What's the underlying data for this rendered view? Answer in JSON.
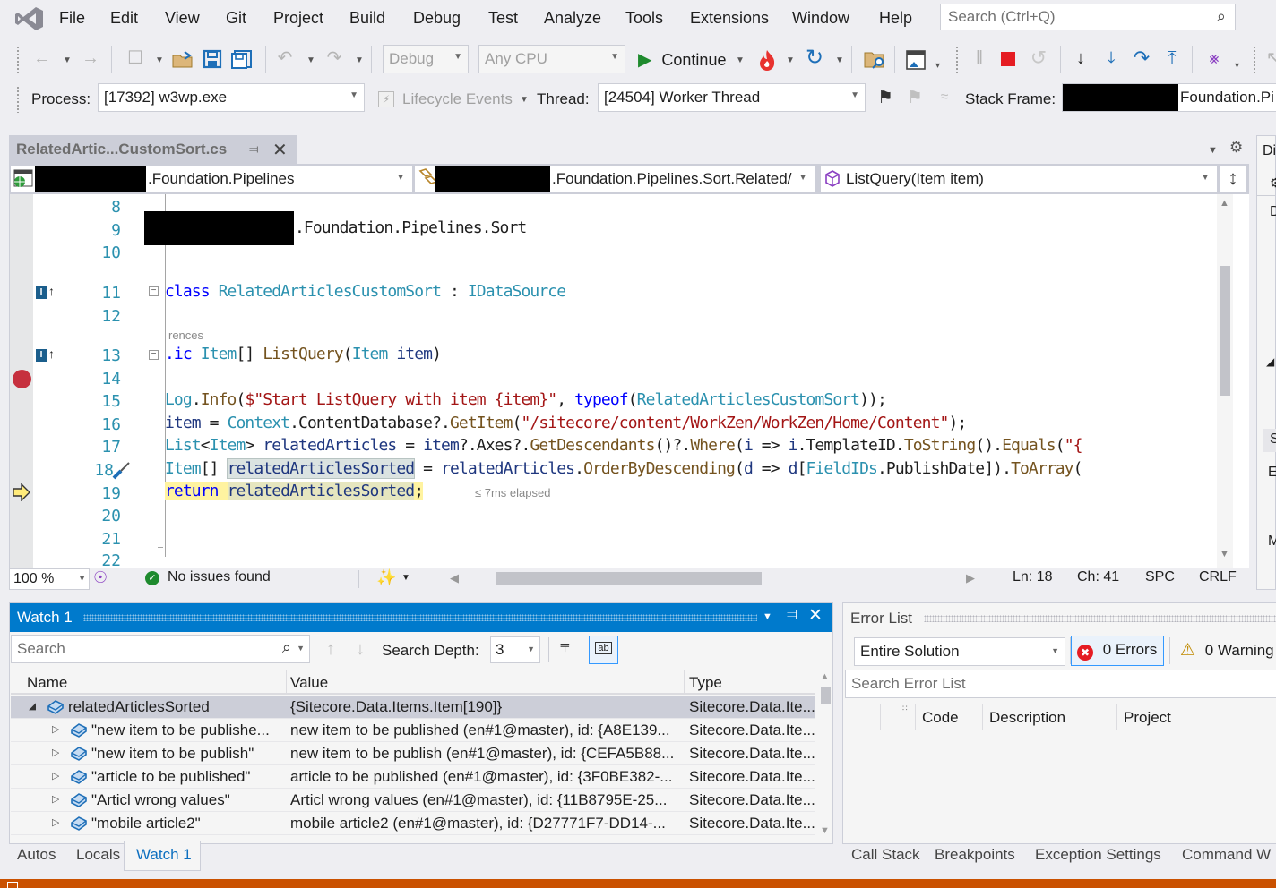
{
  "menu": [
    "File",
    "Edit",
    "View",
    "Git",
    "Project",
    "Build",
    "Debug",
    "Test",
    "Analyze",
    "Tools",
    "Extensions",
    "Window",
    "Help"
  ],
  "search": {
    "placeholder": "Search (Ctrl+Q)"
  },
  "toolbar": {
    "configuration": "Debug",
    "platform": "Any CPU",
    "continue_label": "Continue"
  },
  "debug_location": {
    "process_label": "Process:",
    "process_value": "[17392] w3wp.exe",
    "lifecycle_label": "Lifecycle Events",
    "thread_label": "Thread:",
    "thread_value": "[24504] Worker Thread",
    "stack_frame_label": "Stack Frame:",
    "stack_frame_value": "Foundation.Pi"
  },
  "editor": {
    "tab_title": "RelatedArtic...CustomSort.cs",
    "nav_project": ".Foundation.Pipelines",
    "nav_type": ".Foundation.Pipelines.Sort.Related/",
    "nav_member": "ListQuery(Item item)",
    "line_numbers": [
      "8",
      "9",
      "10",
      "11",
      "12",
      "13",
      "14",
      "15",
      "16",
      "17",
      "18",
      "19",
      "20",
      "21",
      "22"
    ],
    "codelens": "rences",
    "elapsed": "≤ 7ms elapsed",
    "code": {
      "l9": ".Foundation.Pipelines.Sort",
      "l11_kw": "class",
      "l11_name": "RelatedArticlesCustomSort",
      "l11_sep": " : ",
      "l11_iface": "IDataSource",
      "l13_pre": ".ic",
      "l13_type": "Item",
      "l13_arr": "[] ",
      "l13_method": "ListQuery",
      "l13_paren": "(",
      "l13_ptype": "Item",
      "l13_pname": "item",
      "l13_close": ")",
      "l15": {
        "t1": "Log",
        "t2": ".",
        "t3": "Info",
        "t4": "(",
        "t5": "$\"Start ListQuery with item {item}\"",
        "t6": ", ",
        "t7": "typeof",
        "t8": "(",
        "t9": "RelatedArticlesCustomSort",
        "t10": "));"
      },
      "l16": {
        "t1": "item",
        "t2": " = ",
        "t3": "Context",
        "t4": ".ContentDatabase?.",
        "t5": "GetItem",
        "t6": "(",
        "t7": "\"/sitecore/content/WorkZen/WorkZen/Home/Content\"",
        "t8": ");"
      },
      "l17": {
        "t1": "List",
        "t2": "<",
        "t3": "Item",
        "t4": "> ",
        "t5": "relatedArticles",
        "t6": " = ",
        "t7": "item",
        "t8": "?.Axes?.",
        "t9": "GetDescendants",
        "t10": "()?.",
        "t11": "Where",
        "t12": "(",
        "t13": "i",
        "t14": " => ",
        "t15": "i",
        "t16": ".TemplateID.",
        "t17": "ToString",
        "t18": "().",
        "t19": "Equals",
        "t20": "(",
        "t21": "\"{"
      },
      "l18": {
        "t1": "Item",
        "t2": "[] ",
        "t3": "relatedArticlesSorted",
        "t4": " = ",
        "t5": "relatedArticles",
        "t6": ".",
        "t7": "OrderByDescending",
        "t8": "(",
        "t9": "d",
        "t10": " => ",
        "t11": "d",
        "t12": "[",
        "t13": "FieldIDs",
        "t14": ".PublishDate]).",
        "t15": "ToArray",
        "t16": "("
      },
      "l19": {
        "t1": "return ",
        "t2": "relatedArticlesSorted",
        "t3": ";"
      }
    }
  },
  "editor_status": {
    "zoom": "100 %",
    "issues": "No issues found",
    "ln": "Ln: 18",
    "ch": "Ch: 41",
    "spc": "SPC",
    "crlf": "CRLF"
  },
  "watch": {
    "title": "Watch 1",
    "search_placeholder": "Search",
    "search_depth_label": "Search Depth:",
    "search_depth_value": "3",
    "columns": [
      "Name",
      "Value",
      "Type"
    ],
    "rows": [
      {
        "name": "relatedArticlesSorted",
        "value": "{Sitecore.Data.Items.Item[190]}",
        "type": "Sitecore.Data.Ite...",
        "expanded": true
      },
      {
        "name": "\"new item to be publishe...",
        "value": "new item to be published (en#1@master), id: {A8E139...",
        "type": "Sitecore.Data.Ite..."
      },
      {
        "name": "\"new item to be publish\"",
        "value": "new item to be publish (en#1@master), id: {CEFA5B88...",
        "type": "Sitecore.Data.Ite..."
      },
      {
        "name": "\"article to be published\"",
        "value": "article to be published (en#1@master), id: {3F0BE382-...",
        "type": "Sitecore.Data.Ite..."
      },
      {
        "name": "\"Articl wrong values\"",
        "value": "Articl wrong values (en#1@master), id: {11B8795E-25...",
        "type": "Sitecore.Data.Ite..."
      },
      {
        "name": "\"mobile article2\"",
        "value": "mobile article2 (en#1@master), id: {D27771F7-DD14-...",
        "type": "Sitecore.Data.Ite..."
      }
    ]
  },
  "error_list": {
    "title": "Error List",
    "scope": "Entire Solution",
    "errors": "0 Errors",
    "warnings": "0 Warning",
    "search_placeholder": "Search Error List",
    "columns": [
      "Code",
      "Description",
      "Project"
    ]
  },
  "bottom_tabs_left": [
    "Autos",
    "Locals",
    "Watch 1"
  ],
  "bottom_tabs_right": [
    "Call Stack",
    "Breakpoints",
    "Exception Settings",
    "Command W"
  ],
  "right_panel_labels": [
    "Di",
    "D",
    "S",
    "E",
    "M"
  ],
  "colors": {
    "accent": "#007acc",
    "status_bar": "#ca5100",
    "breakpoint": "#c6303e",
    "current_line": "#fff3a0"
  }
}
